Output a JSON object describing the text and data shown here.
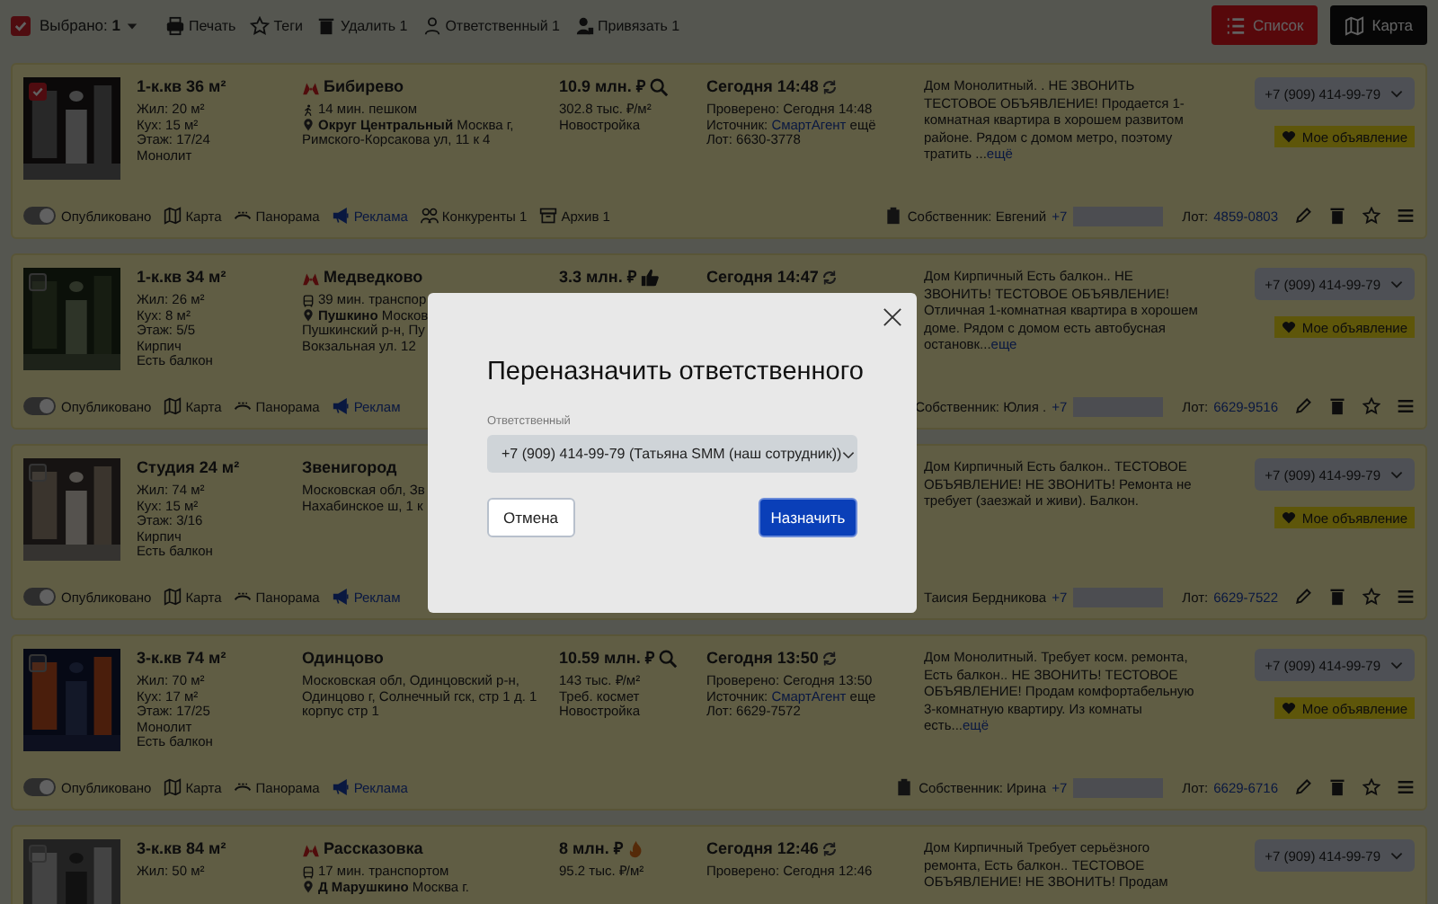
{
  "toolbar": {
    "select": {
      "checked": true,
      "label": "Выбрано: **1**"
    },
    "actions": [
      {
        "kind": "print",
        "label": "Печать"
      },
      {
        "kind": "tag",
        "label": "Теги"
      },
      {
        "kind": "delete",
        "label": "Удалить 1"
      },
      {
        "kind": "person",
        "label": "Ответственный 1"
      },
      {
        "kind": "link-person",
        "label": "Привязать 1"
      }
    ],
    "views": [
      {
        "kind": "list",
        "label": "Список",
        "selected": true
      },
      {
        "kind": "map",
        "label": "Карта",
        "selected": false
      }
    ]
  },
  "listings": [
    {
      "checked": true,
      "title": "1-к.кв 36 м²",
      "specs": [
        "Жил: 20 м²",
        "Кух: 15 м²",
        "Этаж: 17/24",
        "Монолит"
      ],
      "place": {
        "kind": "metro",
        "name": "Бибирево"
      },
      "transit": {
        "kind": "walk",
        "text": "14 мин. пешком"
      },
      "address_pin": true,
      "address": [
        "**Округ Центральный** Москва г,",
        "Римского-Корсакова ул, 11 к 4"
      ],
      "price": {
        "text": "10.9 млн. ₽",
        "kind": "search"
      },
      "price_details": [
        "302.8 тыс. ₽/м²",
        "Новостройка"
      ],
      "date": "Сегодня 14:48",
      "checked_at": "Проверено: Сегодня 14:48",
      "source": {
        "label": "Источник:",
        "name": "СмартАгент",
        "more": "ещё"
      },
      "lot": "Лот: 6630-3778",
      "description": {
        "text": "Дом Монолитный. . НЕ ЗВОНИТЬ ТЕСТОВОЕ ОБЪЯВЛЕНИЕ! Продается 1-комнатная квартира в хорошем развитом районе. Рядом с домом метро, поэтому тратить ...",
        "more": "ещё"
      },
      "phone": "+7 (909) 414-99-79",
      "mine": "Мое объявление",
      "footer": {
        "published": true,
        "published_label": "Опубликовано",
        "actions": [
          {
            "kind": "map",
            "label": "Карта"
          },
          {
            "kind": "panorama",
            "label": "Панорама"
          },
          {
            "kind": "ads",
            "label": "Реклама"
          },
          {
            "kind": "competitors",
            "label": "Конкуренты 1"
          },
          {
            "kind": "archive",
            "label": "Архив 1"
          }
        ],
        "owner_icon": true,
        "owner": "Собственник: Евгений",
        "phone_prefix": "+7",
        "lot_label": "Лот:",
        "lot": "4859-0803"
      }
    },
    {
      "checked": false,
      "title": "1-к.кв 34 м²",
      "specs": [
        "Жил: 26 м²",
        "Кух: 8 м²",
        "Этаж: 5/5",
        "Кирпич",
        "Есть балкон"
      ],
      "place": {
        "kind": "metro",
        "name": "Медведково"
      },
      "transit": {
        "kind": "bus",
        "text": "39 мин. транспор"
      },
      "address_pin": true,
      "address": [
        "**Пушкино** Москов",
        "Пушкинский р-н, Пу",
        "Вокзальная ул. 12"
      ],
      "price": {
        "text": "3.3 млн. ₽",
        "kind": "thumb"
      },
      "date": "Сегодня 14:47",
      "description": {
        "text": "Дом Кирпичный Есть балкон.. НЕ ЗВОНИТЬ! ТЕСТОВОЕ ОБЪЯВЛЕНИЕ! Отличная 1-комнатная квартира в хорошем доме. Рядом с домом есть автобусная остановк...",
        "more": "еще"
      },
      "phone": "+7 (909) 414-99-79",
      "mine": "Мое объявление",
      "footer": {
        "published": true,
        "published_label": "Опубликовано",
        "actions": [
          {
            "kind": "map",
            "label": "Карта"
          },
          {
            "kind": "panorama",
            "label": "Панорама"
          },
          {
            "kind": "ads",
            "label": "Реклам"
          }
        ],
        "owner_icon": false,
        "owner": "Собственник: Юлия .",
        "phone_prefix": "+7",
        "lot_label": "Лот:",
        "lot": "6629-9516"
      }
    },
    {
      "checked": false,
      "title": "Студия 24 м²",
      "specs": [
        "Жил: 74 м²",
        "Кух: 15 м²",
        "Этаж: 3/16",
        "Кирпич",
        "Есть балкон"
      ],
      "place": {
        "kind": "city",
        "name": "Звенигород"
      },
      "address_pin": false,
      "address": [
        "Московская обл, Зв",
        "Нахабинское ш, 1 к"
      ],
      "description": {
        "text": "Дом Кирпичный Есть балкон.. ТЕСТОВОЕ ОБЪЯВЛЕНИЕ! НЕ ЗВОНИТЬ! Ремонта не требует (заезжай и живи). Балкон."
      },
      "phone": "+7 (909) 414-99-79",
      "mine": "Мое объявление",
      "footer": {
        "published": true,
        "published_label": "Опубликовано",
        "actions": [
          {
            "kind": "map",
            "label": "Карта"
          },
          {
            "kind": "panorama",
            "label": "Панорама"
          },
          {
            "kind": "ads",
            "label": "Реклам"
          }
        ],
        "owner_icon": false,
        "owner": "Таисия Бердникова",
        "phone_prefix": "+7",
        "lot_label": "Лот:",
        "lot": "6629-7522"
      }
    },
    {
      "checked": false,
      "title": "3-к.кв 74 м²",
      "specs": [
        "Жил: 70 м²",
        "Кух: 17 м²",
        "Этаж: 17/25",
        "Монолит",
        "Есть балкон"
      ],
      "place": {
        "kind": "city",
        "name": "Одинцово"
      },
      "address_pin": false,
      "address": [
        "Московская обл, Одинцовский р-н,",
        "Одинцово г, Солнечный гск, стр 1 д. 1",
        "корпус стр 1"
      ],
      "price": {
        "text": "10.59 млн. ₽",
        "kind": "search"
      },
      "price_details": [
        "143 тыс. ₽/м²",
        "Треб. космет",
        "Новостройка"
      ],
      "date": "Сегодня 13:50",
      "checked_at": "Проверено: Сегодня 13:50",
      "source": {
        "label": "Источник:",
        "name": "СмартАгент",
        "more": "еще"
      },
      "lot": "Лот: 6629-7572",
      "description": {
        "text": "Дом Монолитный. Требует косм. ремонта, Есть балкон.. НЕ ЗВОНИТЬ! ТЕСТОВОЕ ОБЪЯВЛЕНИЕ! Продам комфортабельную 3-комнатную квартиру. Из комнаты есть...",
        "more": "ещё"
      },
      "phone": "+7 (909) 414-99-79",
      "mine": "Мое объявление",
      "footer": {
        "published": true,
        "published_label": "Опубликовано",
        "actions": [
          {
            "kind": "map",
            "label": "Карта"
          },
          {
            "kind": "panorama",
            "label": "Панорама"
          },
          {
            "kind": "ads",
            "label": "Реклама"
          }
        ],
        "owner_icon": true,
        "owner": "Собственник: Ирина",
        "phone_prefix": "+7",
        "lot_label": "Лот:",
        "lot": "6629-6716"
      }
    },
    {
      "checked": false,
      "title": "3-к.кв 84 м²",
      "specs": [
        "Жил: 50 м²"
      ],
      "place": {
        "kind": "metro",
        "name": "Рассказовка"
      },
      "transit": {
        "kind": "bus",
        "text": "17 мин. транспортом"
      },
      "address_pin": true,
      "address": [
        "**Д Марушкино** Москва г."
      ],
      "price": {
        "text": "8 млн. ₽",
        "kind": "fire"
      },
      "price_details": [
        "95.2 тыс. ₽/м²"
      ],
      "date": "Сегодня 12:46",
      "checked_at": "Проверено: Сегодня 12:46",
      "description": {
        "text": "Дом Кирпичный Требует серьёзного ремонта, Есть балкон.. ТЕСТОВОЕ ОБЪЯВЛЕНИЕ! НЕ ЗВОНИТЬ! Продам"
      },
      "phone": "+7 (909) 414-99-79"
    }
  ],
  "dialog": {
    "title": "Переназначить ответственного",
    "field_label": "Ответственный",
    "value": "+7 (909) 414-99-79 (Татьяна SMM (наш сотрудник))",
    "cancel": "Отмена",
    "confirm": "Назначить"
  }
}
